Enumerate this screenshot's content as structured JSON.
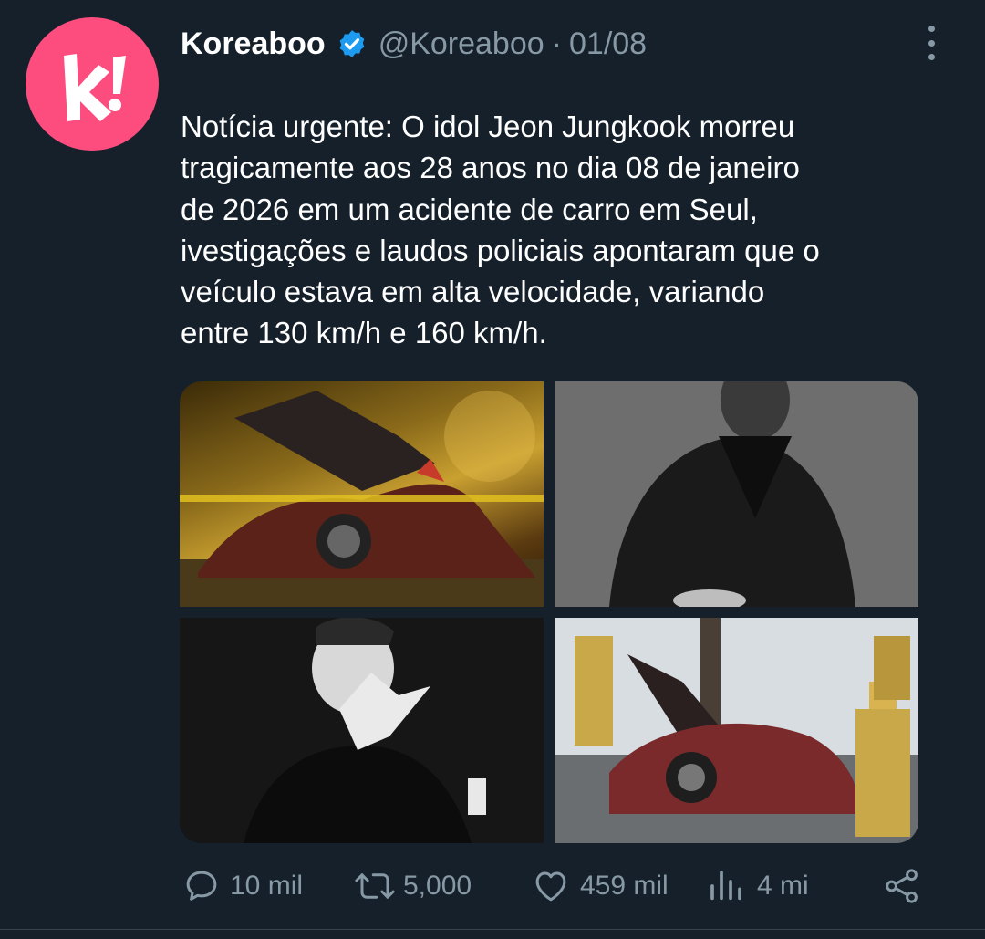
{
  "tweet": {
    "author": {
      "name": "Koreaboo",
      "handle": "@Koreaboo",
      "avatar_letter": "k!",
      "verified": true,
      "brand_color": "#fd4d7e"
    },
    "separator": "·",
    "date": "01/08",
    "text_lines": [
      "Notícia urgente: O idol Jeon Jungkook morreu",
      "tragicamente aos 28 anos no dia 08 de janeiro",
      "de 2026 em um acidente de carro em Seul,",
      "ivestigações e laudos policiais apontaram que o",
      "veículo estava em alta velocidade, variando",
      "entre 130 km/h e 160 km/h."
    ],
    "media": [
      {
        "icon": "photo-car-crash-night-icon"
      },
      {
        "icon": "photo-person-bw-icon"
      },
      {
        "icon": "photo-person-bw-gesture-icon"
      },
      {
        "icon": "photo-car-crash-firefighters-icon"
      }
    ],
    "actions": {
      "reply": {
        "count": "10 mil",
        "icon": "reply-icon"
      },
      "retweet": {
        "count": "5,000",
        "icon": "retweet-icon"
      },
      "like": {
        "count": "459 mil",
        "icon": "heart-icon"
      },
      "views": {
        "count": "4 mi",
        "icon": "analytics-icon"
      },
      "share": {
        "icon": "share-icon"
      }
    },
    "colors": {
      "background": "#15202b",
      "secondary_text": "#8899a6",
      "verified_badge": "#1d9bf0"
    }
  }
}
